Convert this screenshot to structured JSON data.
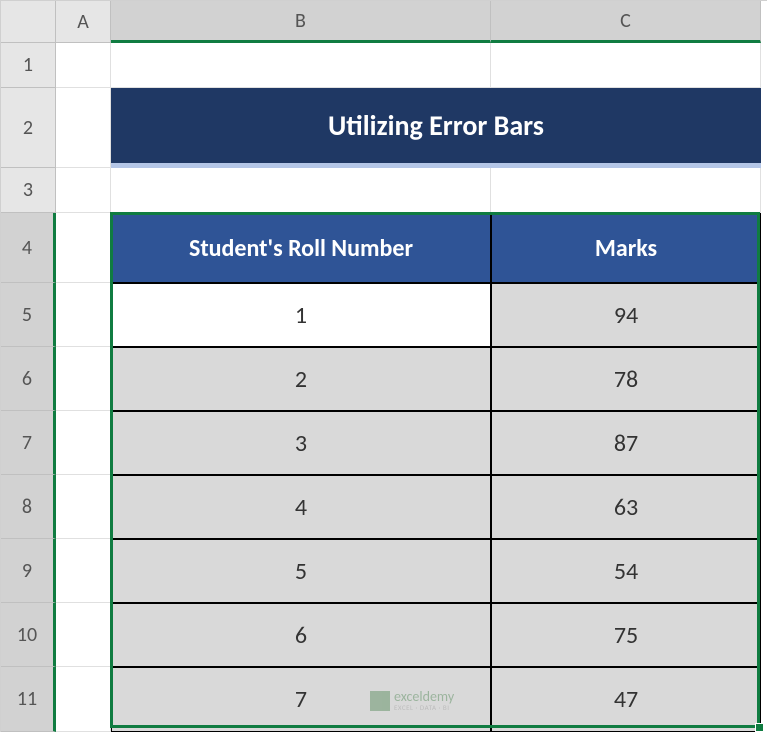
{
  "columns": {
    "A": "A",
    "B": "B",
    "C": "C"
  },
  "rows": {
    "r1": "1",
    "r2": "2",
    "r3": "3",
    "r4": "4",
    "r5": "5",
    "r6": "6",
    "r7": "7",
    "r8": "8",
    "r9": "9",
    "r10": "10",
    "r11": "11"
  },
  "title": "Utilizing Error Bars",
  "headers": {
    "roll": "Student's Roll Number",
    "marks": "Marks"
  },
  "chart_data": {
    "type": "table",
    "title": "Utilizing Error Bars",
    "columns": [
      "Student's Roll Number",
      "Marks"
    ],
    "rows": [
      {
        "roll": "1",
        "marks": "94"
      },
      {
        "roll": "2",
        "marks": "78"
      },
      {
        "roll": "3",
        "marks": "87"
      },
      {
        "roll": "4",
        "marks": "63"
      },
      {
        "roll": "5",
        "marks": "54"
      },
      {
        "roll": "6",
        "marks": "75"
      },
      {
        "roll": "7",
        "marks": "47"
      }
    ]
  },
  "watermark": {
    "main": "exceldemy",
    "sub": "EXCEL · DATA · BI"
  }
}
